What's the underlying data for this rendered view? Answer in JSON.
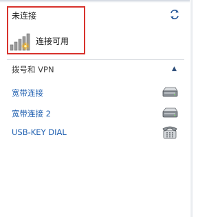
{
  "network_panel": {
    "status": {
      "title": "未连接",
      "subtitle": "连接可用",
      "icon": "wireless-signal-available-icon",
      "highlight_color": "#d8322c"
    },
    "refresh_icon": "refresh-icon",
    "section": {
      "title": "拨号和 VPN",
      "toggle_icon": "chevron-up-icon"
    },
    "connections": [
      {
        "label": "宽带连接",
        "icon": "modem-icon"
      },
      {
        "label": "宽带连接 2",
        "icon": "modem-icon"
      },
      {
        "label": "USB-KEY DIAL",
        "icon": "telephone-icon"
      }
    ],
    "link_color": "#1f5fb0"
  }
}
